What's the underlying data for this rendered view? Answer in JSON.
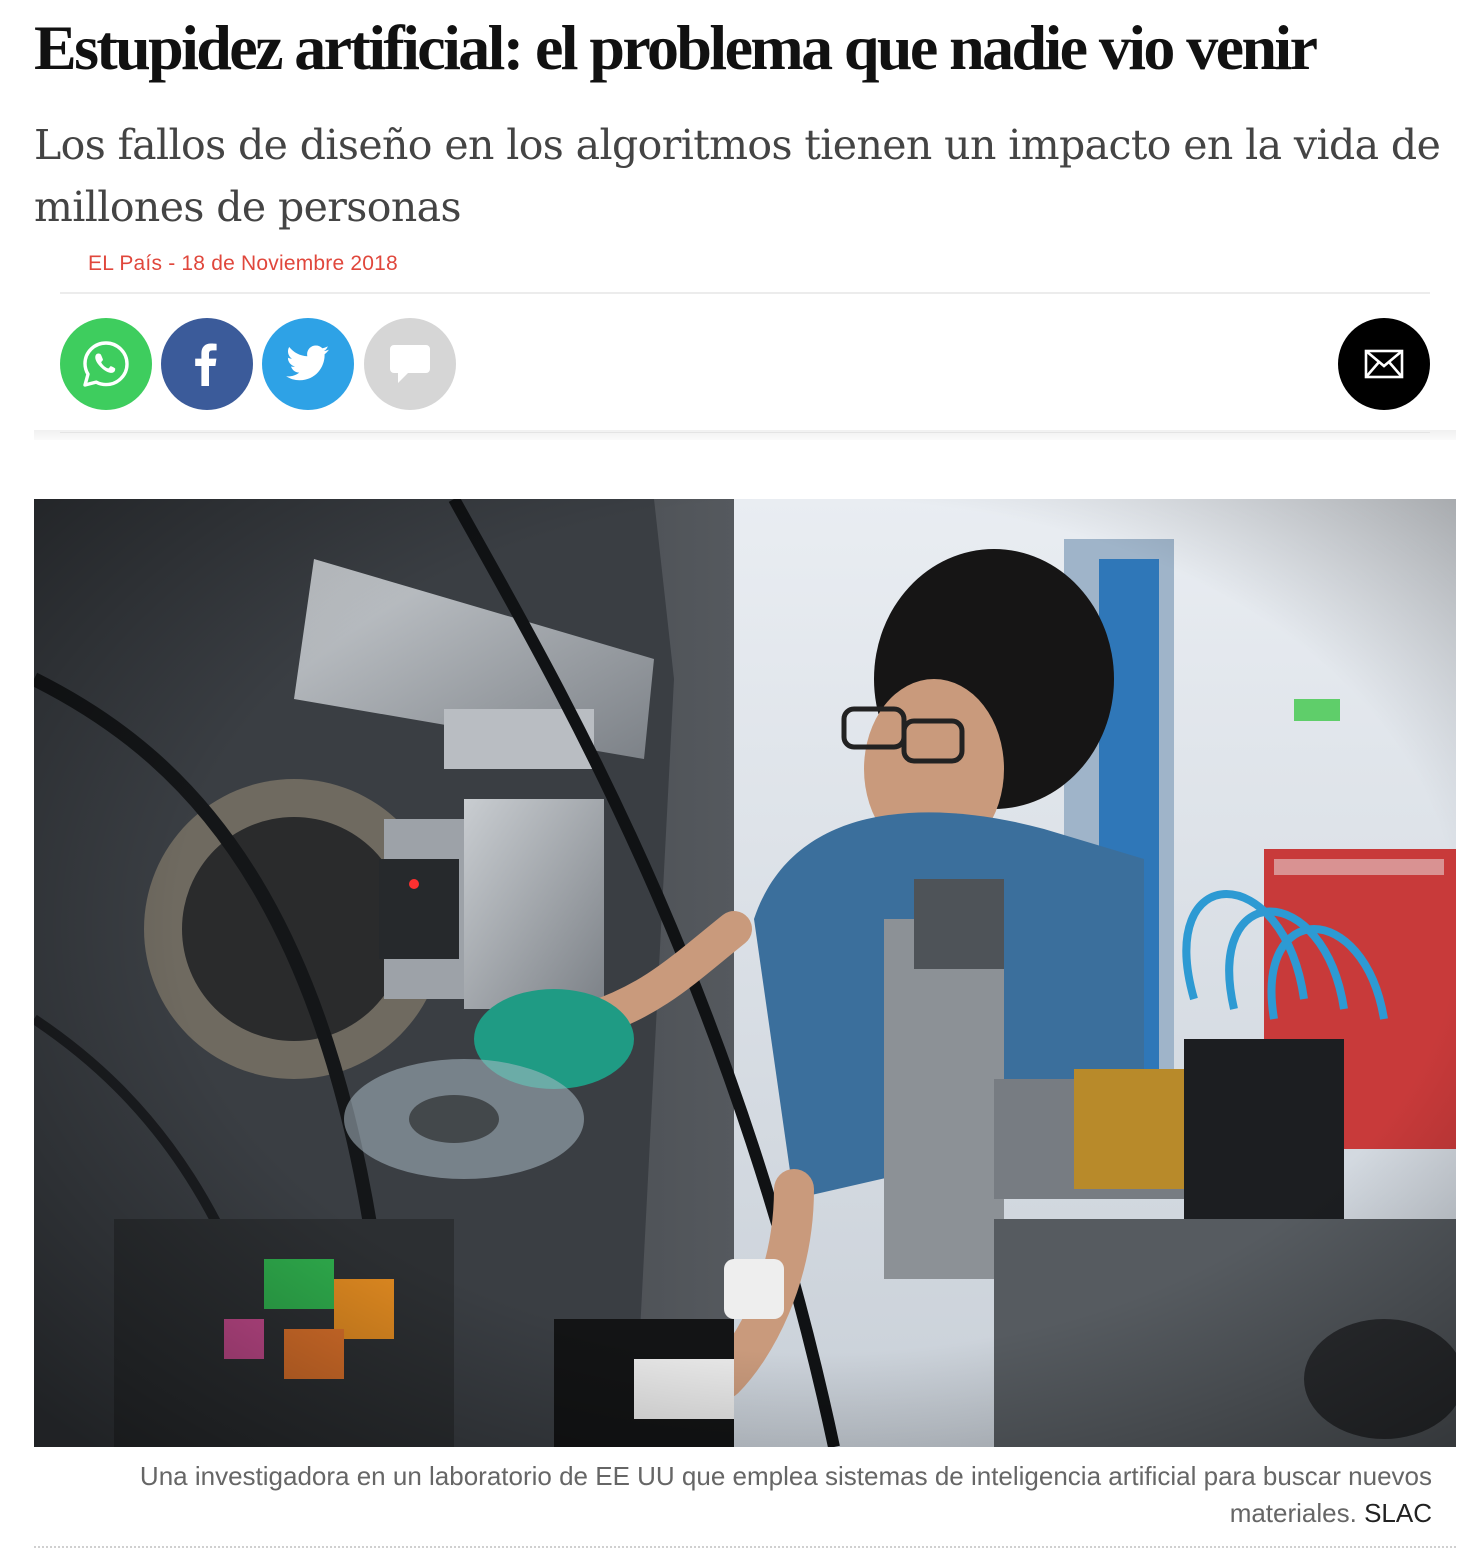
{
  "article": {
    "headline": "Estupidez artificial: el problema que nadie vio venir",
    "subheadline": "Los fallos de diseño en los algoritmos tienen un impacto en la vida de millones de personas",
    "byline": "EL País - 18 de Noviembre 2018"
  },
  "share": {
    "buttons": [
      {
        "name": "whatsapp",
        "icon": "whatsapp-icon",
        "color": "#3ecd5e"
      },
      {
        "name": "facebook",
        "icon": "facebook-icon",
        "color": "#3b5b9a"
      },
      {
        "name": "twitter",
        "icon": "twitter-icon",
        "color": "#2ea2e6"
      },
      {
        "name": "comments",
        "icon": "comment-icon",
        "color": "#d6d6d6"
      },
      {
        "name": "email",
        "icon": "mail-icon",
        "color": "#000000"
      }
    ]
  },
  "photo": {
    "caption": "Una investigadora en un laboratorio de EE UU que emplea sistemas de inteligencia artificial para buscar nuevos materiales.",
    "credit": "SLAC"
  },
  "colors": {
    "byline": "#e0473c",
    "caption": "#666666"
  }
}
